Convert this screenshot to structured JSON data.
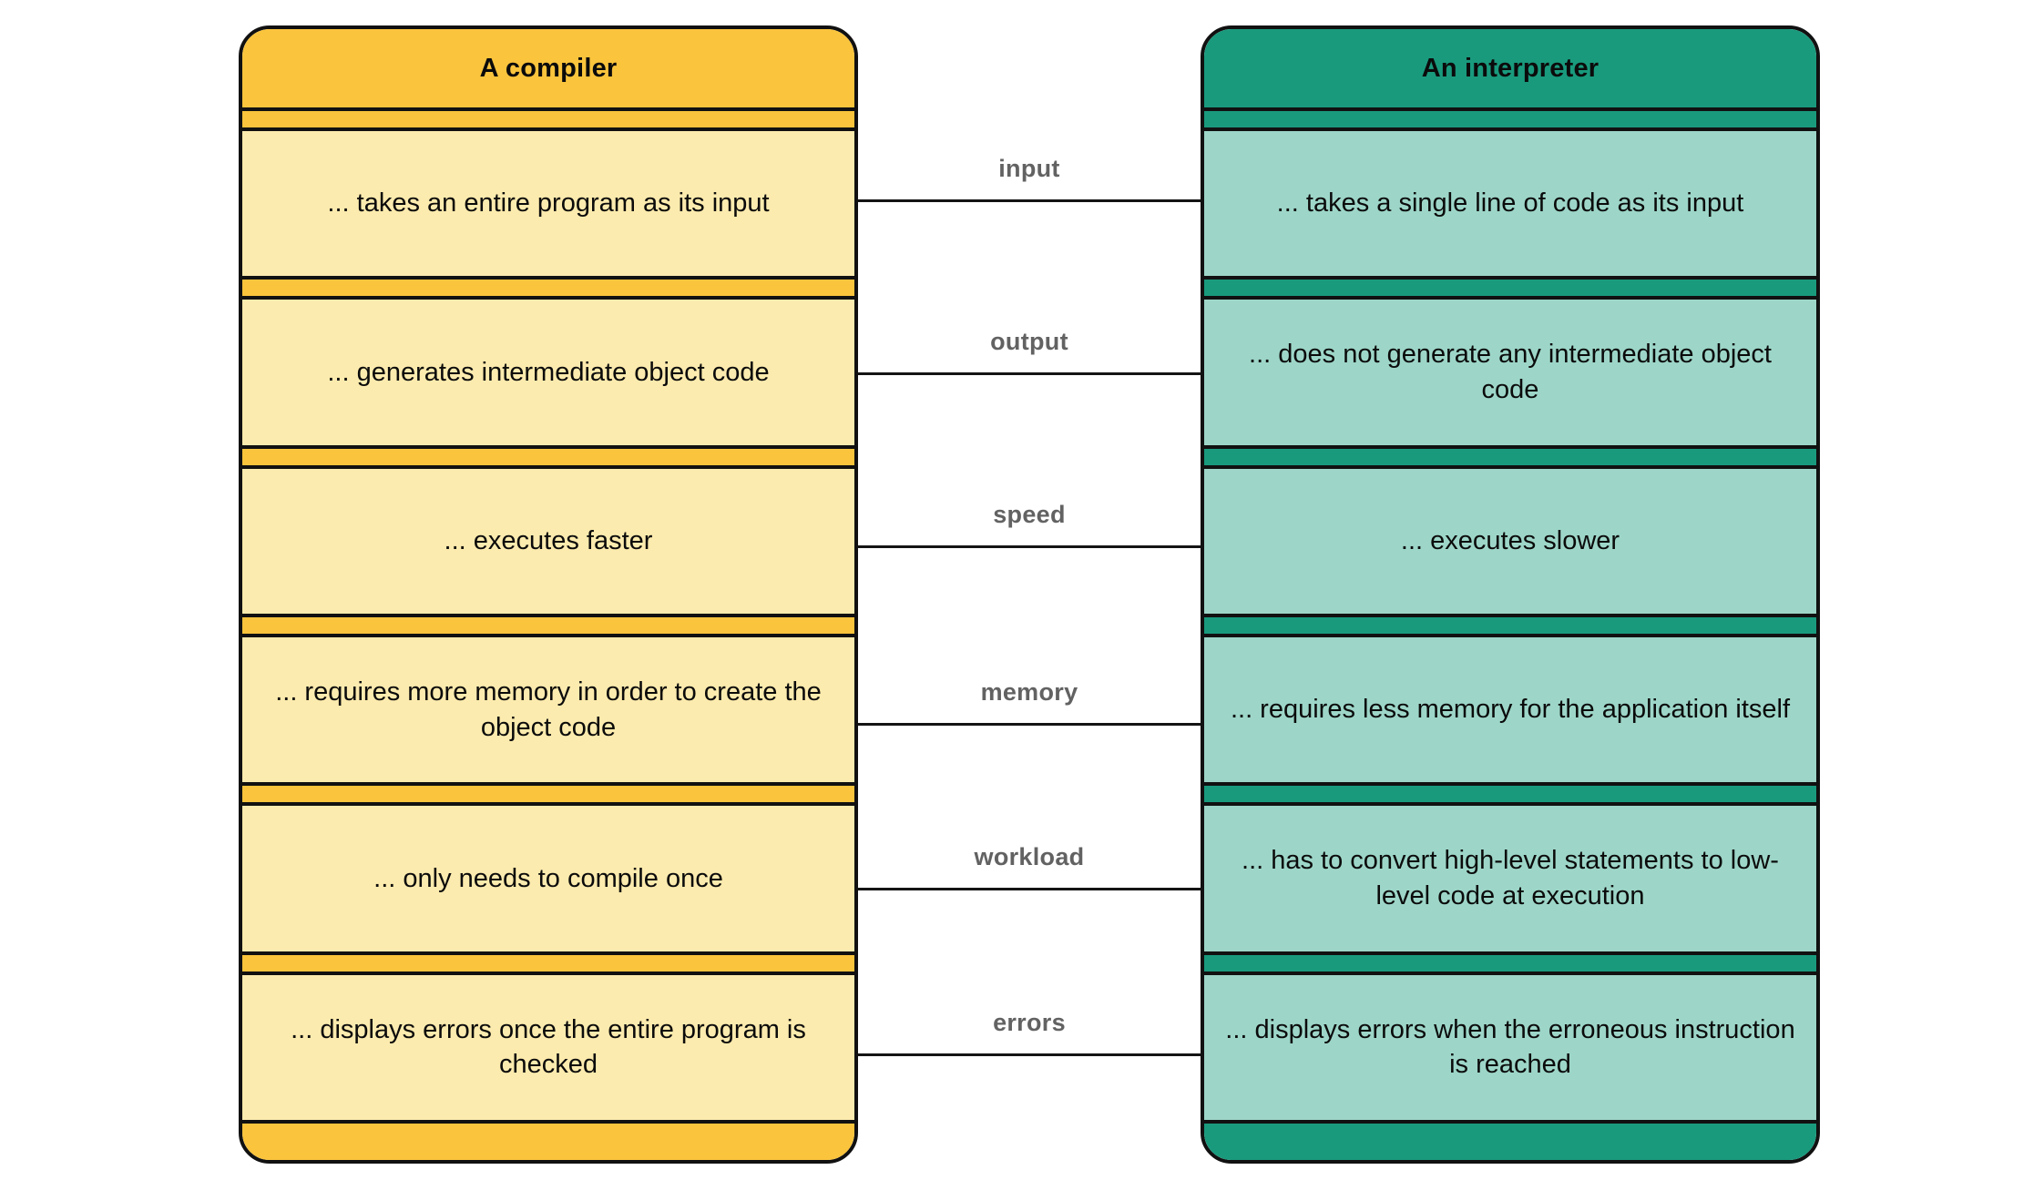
{
  "diagram": {
    "title_hidden": "",
    "left_panel": {
      "name": "compiler-panel",
      "header": "A compiler",
      "accent_color": "#fac43c",
      "body_color": "#fcebae",
      "rows": [
        "... takes an entire program as its input",
        "... generates intermediate object code",
        "... executes faster",
        "... requires more memory in order to create the object code",
        "... only needs to compile once",
        "... displays errors once the entire program is checked"
      ]
    },
    "right_panel": {
      "name": "interpreter-panel",
      "header": "An interpreter",
      "accent_color": "#199a7d",
      "body_color": "#9dd6c8",
      "rows": [
        "... takes a single line of code as its input",
        "... does not generate any intermediate object code",
        "... executes slower",
        "... requires less memory for the application itself",
        "... has to convert high-level statements to low-level code at execution",
        "... displays errors when the erroneous instruction is reached"
      ]
    },
    "connector_labels": [
      "input",
      "output",
      "speed",
      "memory",
      "workload",
      "errors"
    ],
    "connector_label_color": "#626262",
    "line_color": "#141414"
  }
}
